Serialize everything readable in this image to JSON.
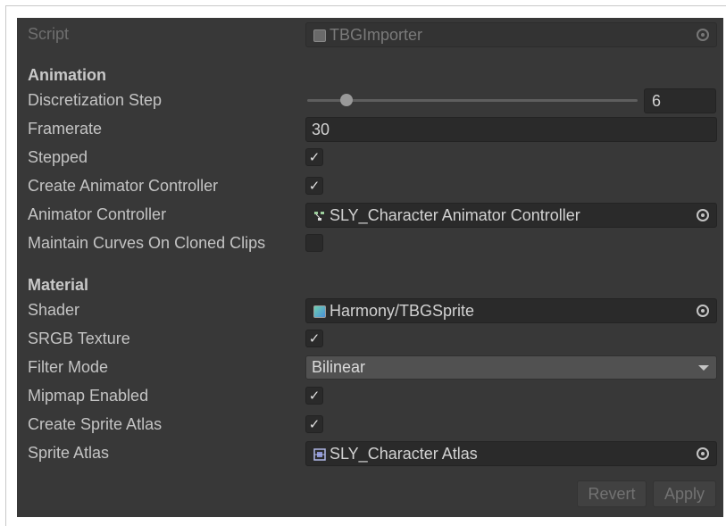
{
  "script_row": {
    "label": "Script",
    "value": "TBGImporter",
    "icon": "script-icon"
  },
  "animation": {
    "header": "Animation",
    "discretization_step": {
      "label": "Discretization Step",
      "value": "6",
      "slider_fraction": 0.12
    },
    "framerate": {
      "label": "Framerate",
      "value": "30"
    },
    "stepped": {
      "label": "Stepped",
      "checked": true
    },
    "create_animator_controller": {
      "label": "Create Animator Controller",
      "checked": true
    },
    "animator_controller": {
      "label": "Animator Controller",
      "value": "SLY_Character Animator Controller",
      "icon": "animator-controller-icon"
    },
    "maintain_curves": {
      "label": "Maintain Curves On Cloned Clips",
      "checked": false
    }
  },
  "material": {
    "header": "Material",
    "shader": {
      "label": "Shader",
      "value": "Harmony/TBGSprite",
      "icon": "shader-icon"
    },
    "srgb_texture": {
      "label": "SRGB Texture",
      "checked": true
    },
    "filter_mode": {
      "label": "Filter Mode",
      "value": "Bilinear"
    },
    "mipmap_enabled": {
      "label": "Mipmap Enabled",
      "checked": true
    },
    "create_sprite_atlas": {
      "label": "Create Sprite Atlas",
      "checked": true
    },
    "sprite_atlas": {
      "label": "Sprite Atlas",
      "value": "SLY_Character Atlas",
      "icon": "sprite-atlas-icon"
    }
  },
  "buttons": {
    "revert": "Revert",
    "apply": "Apply"
  },
  "check_glyph": "✓",
  "colors": {
    "panel_bg": "#383838",
    "field_bg": "#2a2a2a",
    "text": "#c4c4c4",
    "disabled_text": "#6f6f6f"
  }
}
